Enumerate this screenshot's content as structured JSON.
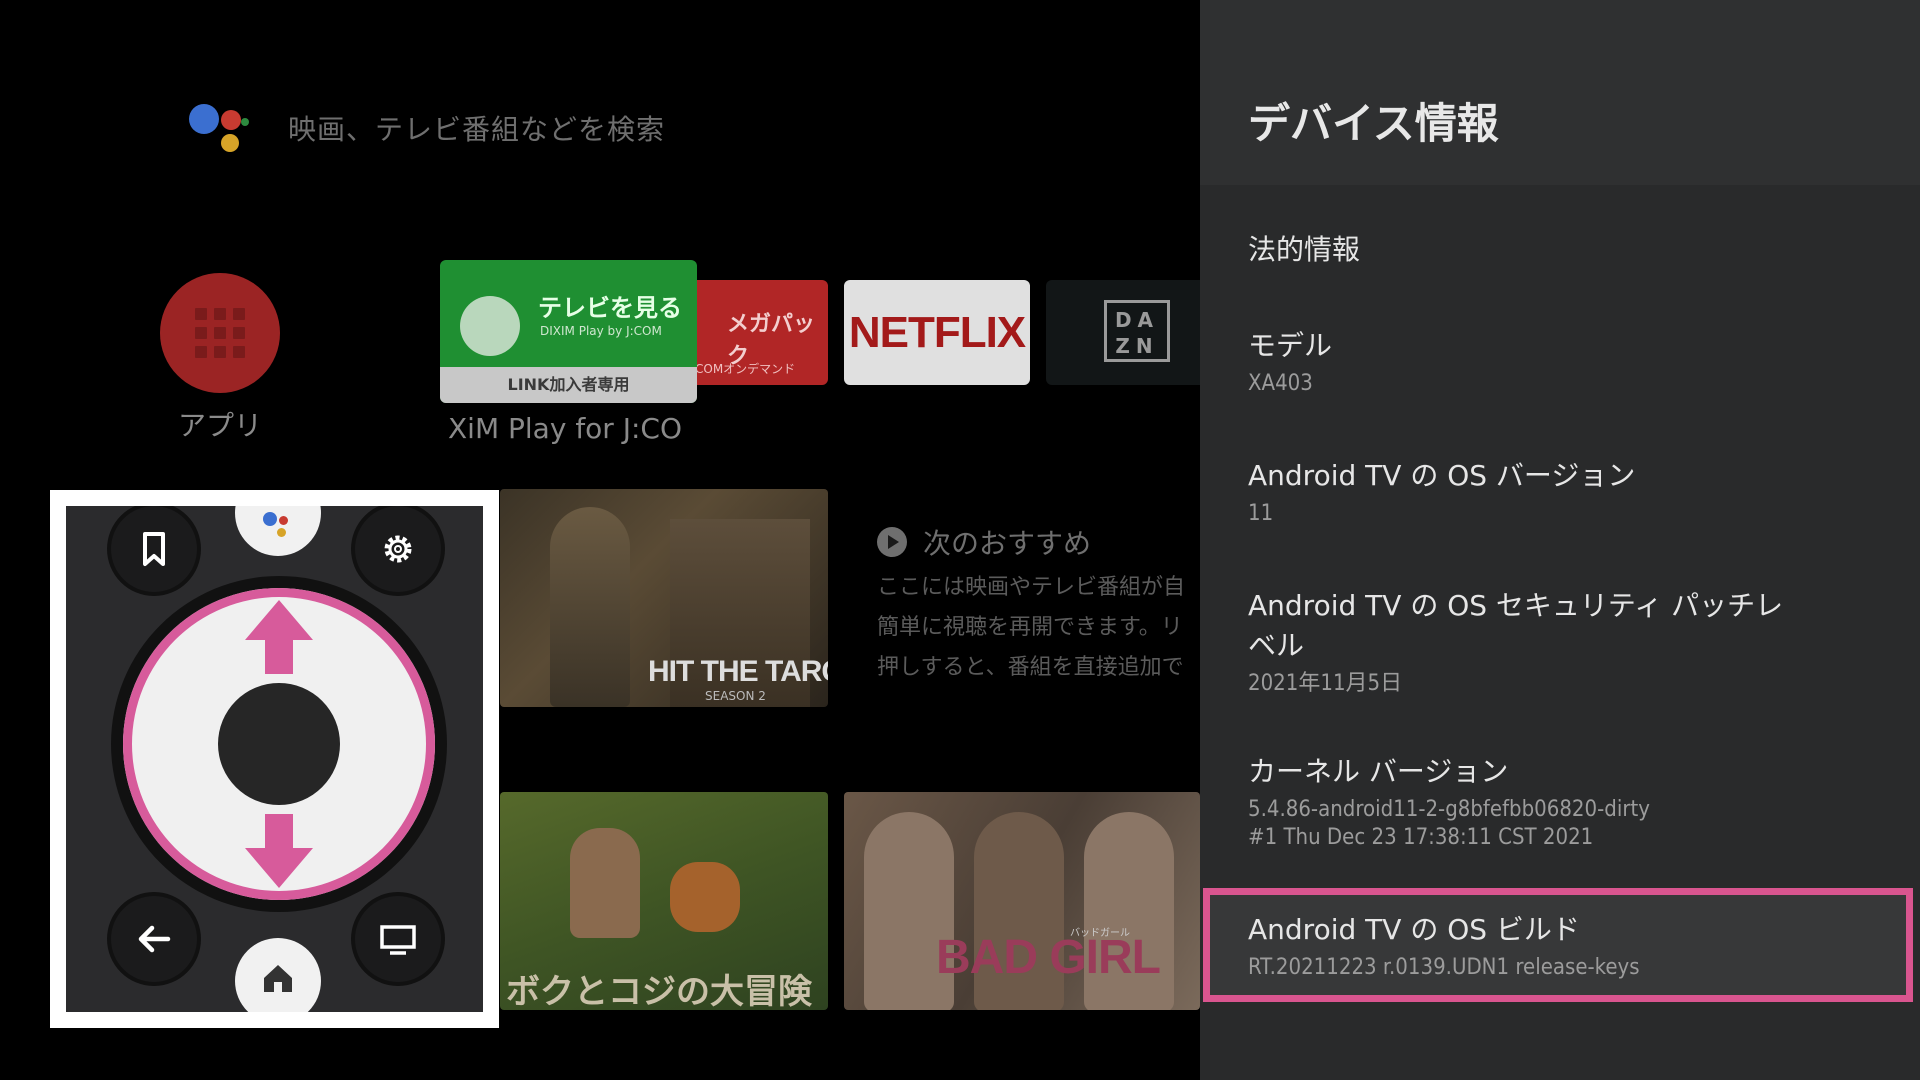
{
  "search": {
    "placeholder": "映画、テレビ番組などを検索"
  },
  "apps": {
    "label": "アプリ"
  },
  "app_tiles": {
    "tv": {
      "title": "テレビを見る",
      "brand": "DIXIM Play by J:COM",
      "band": "LINK加入者専用",
      "caption": "XiM Play for J:CO"
    },
    "mega": {
      "title": "メガパック",
      "sub": "COMオンデマンド"
    },
    "netflix": {
      "title": "NETFLIX"
    },
    "dazn": {
      "title": "DAZN"
    }
  },
  "next": {
    "heading": "次のおすすめ",
    "lines": [
      "ここには映画やテレビ番組が自",
      "簡単に視聴を再開できます。リ",
      "押しすると、番組を直接追加で"
    ]
  },
  "cards": {
    "hit": {
      "title": "HIT THE TARGET",
      "sub": "SEASON 2"
    },
    "fox": {
      "title": "ボクとコジの大冒険"
    },
    "bad": {
      "title": "BAD GIRL",
      "kana": "バッドガール"
    }
  },
  "panel": {
    "title": "デバイス情報",
    "items": [
      {
        "label": "法的情報",
        "value": ""
      },
      {
        "label": "モデル",
        "value": "XA403"
      },
      {
        "label": "Android TV の OS バージョン",
        "value": "11"
      },
      {
        "label": "Android TV の OS セキュリティ パッチレベル",
        "value": "2021年11月5日"
      },
      {
        "label": "カーネル バージョン",
        "value": "5.4.86-android11-2-g8bfefbb06820-dirty",
        "value2": "#1 Thu Dec 23 17:38:11 CST 2021"
      },
      {
        "label": "Android TV の OS ビルド",
        "value": "RT.20211223 r.0139.UDN1 release-keys"
      }
    ]
  },
  "colors": {
    "highlight": "#d9558f",
    "apps_red": "#9b2424",
    "panel_bg": "#292a2b"
  },
  "remote_icons": [
    "bookmark-icon",
    "google-assistant-icon",
    "gear-icon",
    "back-icon",
    "home-icon",
    "tv-icon",
    "up-arrow-icon",
    "down-arrow-icon"
  ]
}
